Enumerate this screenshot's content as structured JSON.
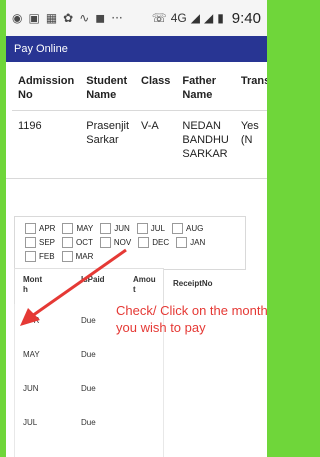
{
  "statusbar": {
    "left_icons": [
      "whatsapp-icon",
      "sms-icon",
      "calendar-icon",
      "settings-icon",
      "wave-icon",
      "message-icon"
    ],
    "more": "···",
    "network": "4G",
    "time": "9:40"
  },
  "header": {
    "title": "Pay Online"
  },
  "student_table": {
    "headers": [
      "Admission No",
      "Student Name",
      "Class",
      "Father Name",
      "Trans"
    ],
    "row": [
      "1196",
      "Prasenjit Sarkar",
      "V-A",
      "NEDAN BANDHU SARKAR",
      "Yes (N"
    ]
  },
  "months": {
    "row1": [
      "APR",
      "MAY",
      "JUN",
      "JUL",
      "AUG"
    ],
    "row2": [
      "SEP",
      "OCT",
      "NOV",
      "DEC",
      "JAN"
    ],
    "row3": [
      "FEB",
      "MAR"
    ]
  },
  "payments": {
    "headers": [
      "Mont h",
      "IsPaid",
      "Amou t",
      "ReceiptNo"
    ],
    "rows": [
      {
        "month": "APR",
        "paid": "Due"
      },
      {
        "month": "MAY",
        "paid": "Due"
      },
      {
        "month": "JUN",
        "paid": "Due"
      },
      {
        "month": "JUL",
        "paid": "Due"
      }
    ]
  },
  "annotation": {
    "text": "Check/ Click on the month you wish to pay"
  },
  "colors": {
    "header_bg": "#283593",
    "annotation": "#e53935",
    "border": "#6fd63a"
  }
}
